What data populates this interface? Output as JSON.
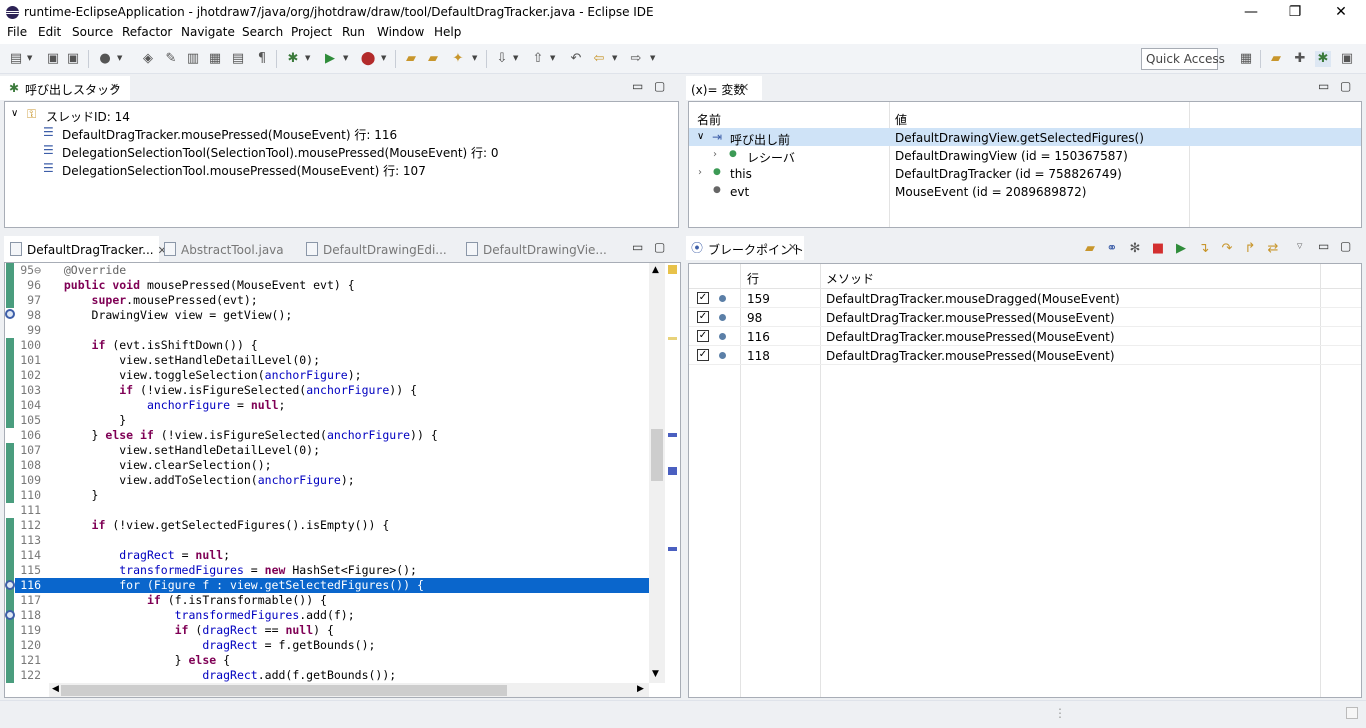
{
  "window": {
    "title": "runtime-EclipseApplication - jhotdraw7/java/org/jhotdraw/draw/tool/DefaultDragTracker.java - Eclipse IDE",
    "minimize": "—",
    "maximize": "❐",
    "close": "✕"
  },
  "menu": [
    "File",
    "Edit",
    "Source",
    "Refactor",
    "Navigate",
    "Search",
    "Project",
    "Run",
    "Window",
    "Help"
  ],
  "toolbar": {
    "quick_access": "Quick Access"
  },
  "callstack": {
    "title": "呼び出しスタック",
    "thread": "スレッドID: 14",
    "frames": [
      "DefaultDragTracker.mousePressed(MouseEvent) 行: 116",
      "DelegationSelectionTool(SelectionTool).mousePressed(MouseEvent) 行: 0",
      "DelegationSelectionTool.mousePressed(MouseEvent) 行: 107"
    ]
  },
  "variables": {
    "title": "(x)= 変数",
    "col_name": "名前",
    "col_value": "値",
    "rows": [
      {
        "name": "呼び出し前",
        "value": "DefaultDrawingView.getSelectedFigures()"
      },
      {
        "name": "レシーバ",
        "value": "DefaultDrawingView (id = 150367587)"
      },
      {
        "name": "this",
        "value": "DefaultDragTracker (id = 758826749)"
      },
      {
        "name": "evt",
        "value": "MouseEvent (id = 2089689872)"
      }
    ]
  },
  "editor": {
    "tabs": [
      "DefaultDragTracker...",
      "AbstractTool.java",
      "DefaultDrawingEdi...",
      "DefaultDrawingVie..."
    ],
    "line_numbers": [
      "95⊖",
      "96",
      "97",
      "98",
      "99",
      "100",
      "101",
      "102",
      "103",
      "104",
      "105",
      "106",
      "107",
      "108",
      "109",
      "110",
      "111",
      "112",
      "113",
      "114",
      "115",
      "116",
      "117",
      "118",
      "119",
      "120",
      "121",
      "122"
    ],
    "highlight_line": "116"
  },
  "breakpoints": {
    "title": "ブレークポイント",
    "col_line": "行",
    "col_method": "メソッド",
    "rows": [
      {
        "line": "159",
        "method": "DefaultDragTracker.mouseDragged(MouseEvent)"
      },
      {
        "line": "98",
        "method": "DefaultDragTracker.mousePressed(MouseEvent)"
      },
      {
        "line": "116",
        "method": "DefaultDragTracker.mousePressed(MouseEvent)"
      },
      {
        "line": "118",
        "method": "DefaultDragTracker.mousePressed(MouseEvent)"
      }
    ]
  },
  "icons": [
    "bug-icon",
    "play-icon",
    "stop-icon",
    "gear-icon",
    "folder-icon",
    "stack-frame-icon",
    "thread-icon",
    "check-icon"
  ],
  "colors": {
    "selection": "#0a66cc",
    "row_select": "#cfe3f7",
    "ruler": "#4a9d7e",
    "keyword": "#7f0055",
    "field": "#0000c0"
  }
}
